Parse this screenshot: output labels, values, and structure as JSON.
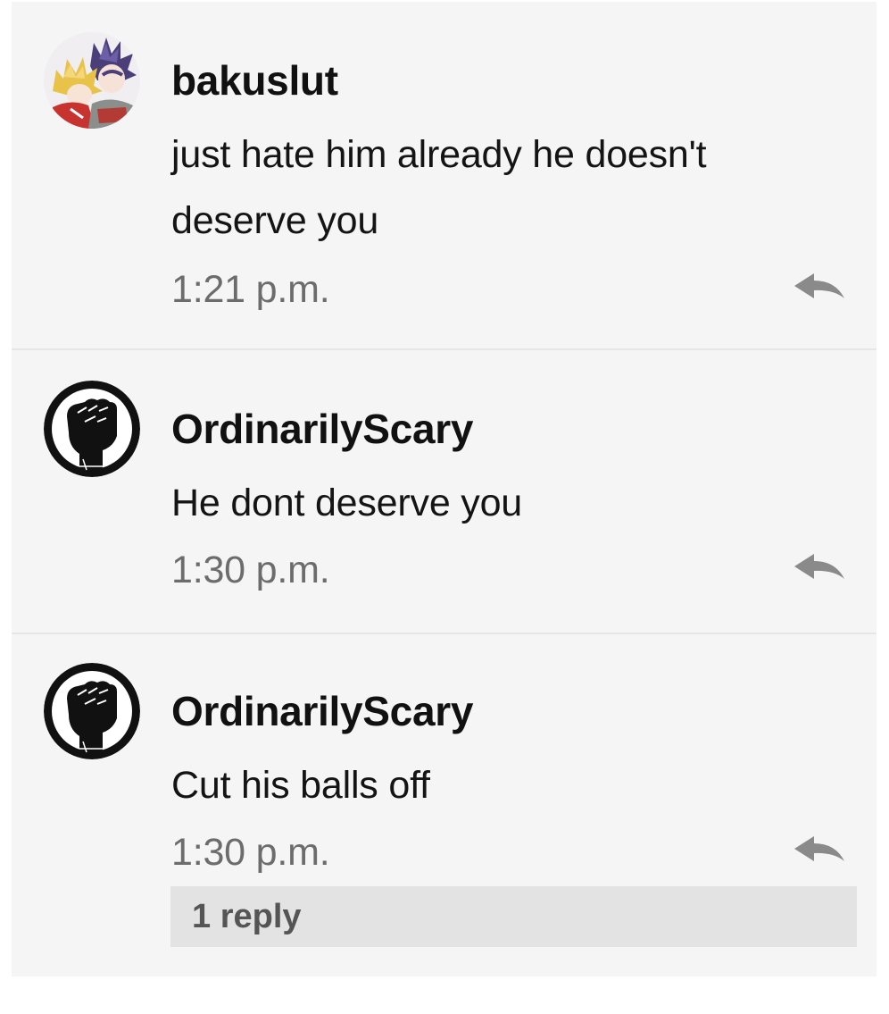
{
  "comments": [
    {
      "username": "bakuslut",
      "avatar_icon": "anime-characters-avatar",
      "text_lines": [
        "just hate him already he doesn't",
        "deserve you"
      ],
      "time": "1:21 p.m.",
      "reply_icon": "reply-arrow-icon"
    },
    {
      "username": "OrdinarilyScary",
      "avatar_icon": "raised-fist-avatar",
      "text_lines": [
        "He dont deserve you"
      ],
      "time": "1:30 p.m.",
      "reply_icon": "reply-arrow-icon"
    },
    {
      "username": "OrdinarilyScary",
      "avatar_icon": "raised-fist-avatar",
      "text_lines": [
        "Cut his balls off"
      ],
      "time": "1:30 p.m.",
      "reply_icon": "reply-arrow-icon",
      "replies_label": "1 reply"
    }
  ],
  "colors": {
    "background": "#f5f5f5",
    "divider": "#e6e6e6",
    "username": "#111111",
    "timestamp": "#6c6c6c",
    "reply_icon": "#8a8a8a",
    "replies_bar": "#e3e3e3"
  }
}
